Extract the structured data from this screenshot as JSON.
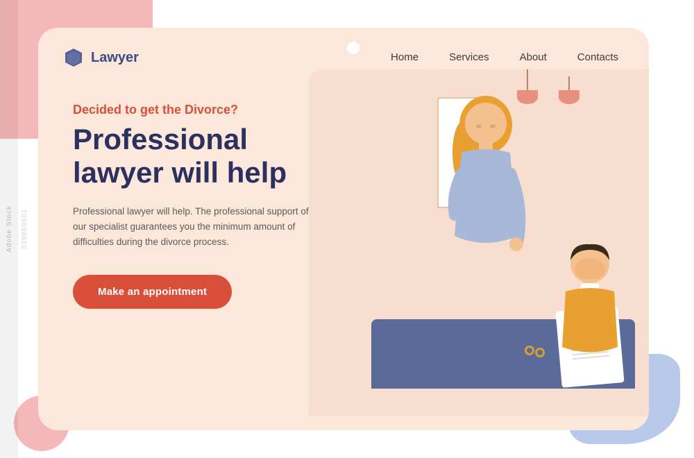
{
  "brand": {
    "logo_text": "Lawyer",
    "logo_icon": "⬡"
  },
  "nav": {
    "links": [
      {
        "label": "Home",
        "href": "#"
      },
      {
        "label": "Services",
        "href": "#"
      },
      {
        "label": "About",
        "href": "#"
      },
      {
        "label": "Contacts",
        "href": "#"
      }
    ]
  },
  "hero": {
    "subtitle": "Decided to get the Divorce?",
    "title": "Professional lawyer will help",
    "description": "Professional lawyer will help. The professional support of our specialist guarantees you the minimum amount of difficulties during the divorce process.",
    "cta_label": "Make an appointment"
  },
  "colors": {
    "accent": "#d94f3a",
    "dark_blue": "#2c3060",
    "card_bg": "#fce8da",
    "logo_color": "#3a4a8a"
  },
  "watermark": {
    "text": "Adobe Stock",
    "number": "339889601"
  }
}
